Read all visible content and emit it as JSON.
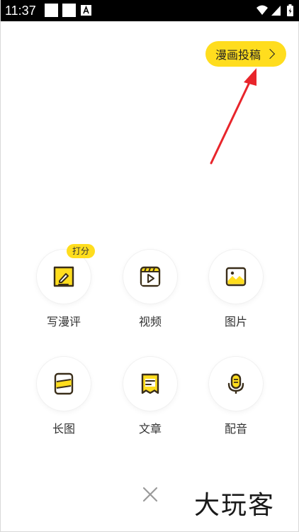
{
  "status_bar": {
    "time": "11:37",
    "icons": [
      "notification-square-icon",
      "notification-square-icon",
      "a-box-icon",
      "wifi-icon",
      "signal-icon",
      "battery-charging-icon"
    ]
  },
  "submit": {
    "label": "漫画投稿"
  },
  "grid": {
    "items": [
      {
        "label": "写漫评",
        "icon": "edit-note-icon",
        "badge": "打分"
      },
      {
        "label": "视频",
        "icon": "video-icon"
      },
      {
        "label": "图片",
        "icon": "image-icon"
      },
      {
        "label": "长图",
        "icon": "long-image-icon"
      },
      {
        "label": "文章",
        "icon": "article-icon"
      },
      {
        "label": "配音",
        "icon": "microphone-icon"
      }
    ]
  },
  "watermark": "大玩客",
  "colors": {
    "accent": "#ffdd1e",
    "icon_dark": "#3a2e1a",
    "annotation_red": "#e8252b"
  }
}
